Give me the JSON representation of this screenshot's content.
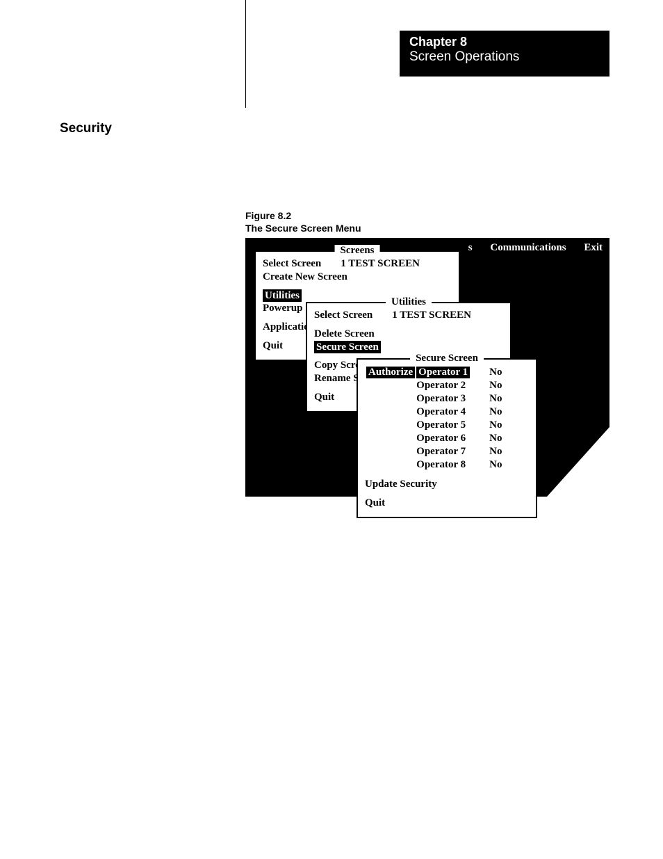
{
  "chapter": {
    "num": "Chapter 8",
    "title": "Screen Operations"
  },
  "section": "Security",
  "figure_label": {
    "num": "Figure 8.2",
    "title": "The Secure Screen Menu"
  },
  "menubar": {
    "a": "s",
    "b": "Communications",
    "c": "Exit"
  },
  "panel1": {
    "title": "Screens",
    "select": "Select Screen",
    "selected_screen": "1 TEST SCREEN",
    "create": "Create New Screen",
    "utilities": "Utilities",
    "powerup": "Powerup",
    "applicatio": "Applicatio",
    "quit": "Quit"
  },
  "panel2": {
    "title": "Utilities",
    "select": "Select Screen",
    "selected_screen": "1 TEST SCREEN",
    "delete": "Delete Screen",
    "secure": "Secure Screen",
    "copy": "Copy Scre",
    "rename": "Rename S",
    "quit": "Quit"
  },
  "panel3": {
    "title": "Secure Screen",
    "authorize": "Authorize",
    "ops": [
      {
        "name": "Operator 1",
        "val": "No"
      },
      {
        "name": "Operator 2",
        "val": "No"
      },
      {
        "name": "Operator 3",
        "val": "No"
      },
      {
        "name": "Operator 4",
        "val": "No"
      },
      {
        "name": "Operator 5",
        "val": "No"
      },
      {
        "name": "Operator 6",
        "val": "No"
      },
      {
        "name": "Operator 7",
        "val": "No"
      },
      {
        "name": "Operator 8",
        "val": "No"
      }
    ],
    "update": "Update Security",
    "quit": "Quit"
  }
}
